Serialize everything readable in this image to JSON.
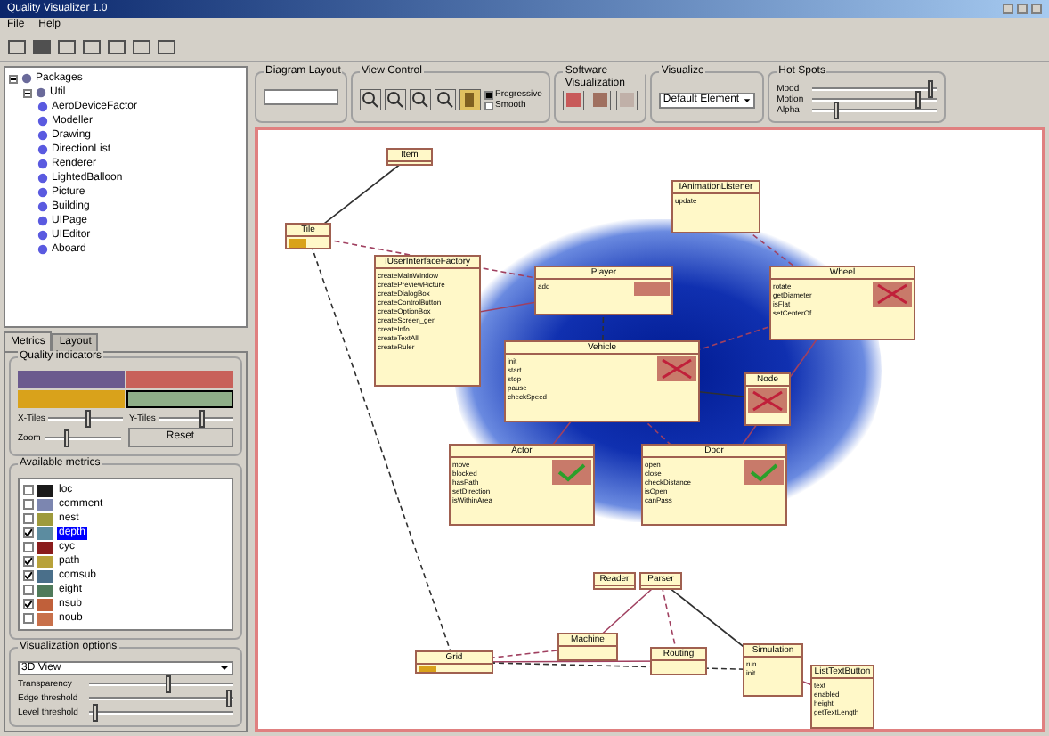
{
  "window": {
    "title": "Quality Visualizer 1.0"
  },
  "menu": [
    "File",
    "Help"
  ],
  "tree": {
    "label": "Packages",
    "expanded": true,
    "children": [
      {
        "label": "Util",
        "expanded": true,
        "children": [
          {
            "label": "AeroDeviceFactor"
          },
          {
            "label": "Modeller"
          },
          {
            "label": "Drawing"
          },
          {
            "label": "DirectionList"
          },
          {
            "label": "Renderer"
          },
          {
            "label": "LightedBalloon"
          },
          {
            "label": "Picture"
          },
          {
            "label": "Building"
          },
          {
            "label": "UIPage"
          },
          {
            "label": "UIEditor"
          },
          {
            "label": "Aboard"
          }
        ]
      }
    ]
  },
  "tabs": [
    {
      "label": "Metrics",
      "selected": true
    },
    {
      "label": "Layout",
      "selected": false
    }
  ],
  "quality_colors": {
    "title": "Quality indicators",
    "items": [
      {
        "color": "#6b5a8e",
        "selected": false
      },
      {
        "color": "#c8615a",
        "selected": false
      },
      {
        "color": "#d9a21b",
        "selected": false
      },
      {
        "color": "#8fae88",
        "selected": true
      }
    ]
  },
  "tile_sliders": [
    {
      "label": "X-Tiles",
      "level": 0.55
    },
    {
      "label": "Y-Tiles",
      "level": 0.6
    },
    {
      "label": "Zoom",
      "level": 0.3
    }
  ],
  "reset_button": "Reset",
  "metrics": {
    "title": "Available metrics",
    "items": [
      {
        "label": "loc",
        "checked": false,
        "selected": false,
        "color": "#1a1a1a"
      },
      {
        "label": "comment",
        "checked": false,
        "selected": false,
        "color": "#7c86b0"
      },
      {
        "label": "nest",
        "checked": false,
        "selected": false,
        "color": "#9e9a3c"
      },
      {
        "label": "depth",
        "checked": true,
        "selected": true,
        "color": "#5c8ca0"
      },
      {
        "label": "cyc",
        "checked": false,
        "selected": false,
        "color": "#8a1c1c"
      },
      {
        "label": "path",
        "checked": true,
        "selected": false,
        "color": "#b8a23a"
      },
      {
        "label": "comsub",
        "checked": true,
        "selected": false,
        "color": "#4a6f8a"
      },
      {
        "label": "eight",
        "checked": false,
        "selected": false,
        "color": "#4f7a5a"
      },
      {
        "label": "nsub",
        "checked": true,
        "selected": false,
        "color": "#c0603a"
      },
      {
        "label": "noub",
        "checked": false,
        "selected": false,
        "color": "#c8704a"
      }
    ]
  },
  "visualization": {
    "title": "Visualization options",
    "mode": "3D View",
    "sliders": [
      {
        "label": "Transparency",
        "level": 0.55
      },
      {
        "label": "Edge threshold",
        "level": 0.98
      },
      {
        "label": "Level threshold",
        "level": 0.05
      }
    ]
  },
  "toolbar_groups": {
    "layout": {
      "title": "Diagram Layout"
    },
    "view": {
      "title": "View Control",
      "options": [
        {
          "label": "Progressive",
          "checked": true
        },
        {
          "label": "Smooth",
          "checked": false
        }
      ]
    },
    "software": {
      "title": "Software Visualization"
    },
    "visualize": {
      "title": "Visualize",
      "value": "Default Element"
    },
    "hotspots": {
      "title": "Hot Spots",
      "sliders": [
        {
          "label": "Mood",
          "level": 0.95
        },
        {
          "label": "Motion",
          "level": 0.85
        },
        {
          "label": "Alpha",
          "level": 0.2
        }
      ]
    }
  },
  "diagram": {
    "nodes": [
      {
        "title": "Item",
        "kind": "plain"
      },
      {
        "title": "Tile",
        "kind": "swatch"
      },
      {
        "title": "IUserInterfaceFactory",
        "members": [
          "createMainWindow",
          "createPreviewPicture",
          "createDialogBox",
          "createControlButton",
          "createOptionBox",
          "createScreen_gen",
          "createInfo",
          "createTextAll",
          "createRuler"
        ],
        "kind": "plain"
      },
      {
        "title": "Player",
        "members": [
          "add"
        ],
        "kind": "bar"
      },
      {
        "title": "IAnimationListener",
        "members": [
          "update"
        ],
        "kind": "plain"
      },
      {
        "title": "Wheel",
        "members": [
          "rotate",
          "getDiameter",
          "isFlat",
          "setCenterOf"
        ],
        "kind": "cross"
      },
      {
        "title": "Vehicle",
        "members": [
          "init",
          "start",
          "stop",
          "pause",
          "checkSpeed"
        ],
        "kind": "cross"
      },
      {
        "title": "Node",
        "kind": "cross"
      },
      {
        "title": "Actor",
        "members": [
          "move",
          "blocked",
          "hasPath",
          "setDirection",
          "isWithinArea"
        ],
        "kind": "check"
      },
      {
        "title": "Door",
        "members": [
          "open",
          "close",
          "checkDistance",
          "isOpen",
          "canPass"
        ],
        "kind": "check"
      },
      {
        "title": "Reader",
        "kind": "plain"
      },
      {
        "title": "Parser",
        "kind": "plain"
      },
      {
        "title": "Machine",
        "kind": "plain"
      },
      {
        "title": "Routing",
        "kind": "plain"
      },
      {
        "title": "Simulation",
        "members": [
          "run",
          "init"
        ],
        "kind": "plain"
      },
      {
        "title": "ListTextButton",
        "members": [
          "text",
          "enabled",
          "height",
          "getTextLength"
        ],
        "kind": "plain"
      },
      {
        "title": "Grid",
        "kind": "swatch"
      }
    ]
  }
}
